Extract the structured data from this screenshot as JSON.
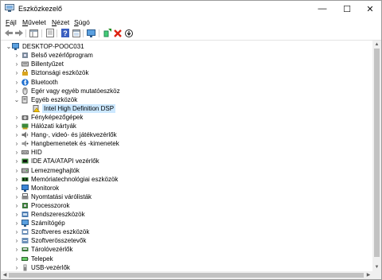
{
  "window": {
    "title": "Eszközkezelő",
    "minimize": "—",
    "maximize": "☐",
    "close": "✕"
  },
  "menu": [
    {
      "accel": "F",
      "rest": "ájl"
    },
    {
      "accel": "M",
      "rest": "űvelet"
    },
    {
      "accel": "N",
      "rest": "ézet"
    },
    {
      "accel": "S",
      "rest": "úgó"
    }
  ],
  "tree": {
    "root": "DESKTOP-POOC031",
    "items": [
      {
        "label": "Belső vezérlőprogram",
        "icon": "firmware-icon"
      },
      {
        "label": "Billentyűzet",
        "icon": "keyboard-icon"
      },
      {
        "label": "Biztonsági eszközök",
        "icon": "security-device-icon"
      },
      {
        "label": "Bluetooth",
        "icon": "bluetooth-icon"
      },
      {
        "label": "Egér vagy egyéb mutatóeszköz",
        "icon": "mouse-icon"
      },
      {
        "label": "Egyéb eszközök",
        "icon": "other-device-icon",
        "expanded": true
      },
      {
        "label": "Intel High Definition DSP",
        "icon": "unknown-device-warning-icon",
        "child": true,
        "selected": true
      },
      {
        "label": "Fényképezőgépek",
        "icon": "camera-icon"
      },
      {
        "label": "Hálózati kártyák",
        "icon": "network-adapter-icon"
      },
      {
        "label": "Hang-, videó- és játékvezérlők",
        "icon": "sound-icon"
      },
      {
        "label": "Hangbemenetek és -kimenetek",
        "icon": "audio-io-icon"
      },
      {
        "label": "HID",
        "icon": "hid-icon"
      },
      {
        "label": "IDE ATA/ATAPI vezérlők",
        "icon": "ide-controller-icon"
      },
      {
        "label": "Lemezmeghajtók",
        "icon": "disk-drive-icon"
      },
      {
        "label": "Memóriatechnológiai eszközök",
        "icon": "memory-device-icon"
      },
      {
        "label": "Monitorok",
        "icon": "monitor-icon"
      },
      {
        "label": "Nyomtatási várólisták",
        "icon": "print-queue-icon"
      },
      {
        "label": "Processzorok",
        "icon": "processor-icon"
      },
      {
        "label": "Rendszereszközök",
        "icon": "system-device-icon"
      },
      {
        "label": "Számítógép",
        "icon": "computer-icon"
      },
      {
        "label": "Szoftveres eszközök",
        "icon": "software-device-icon"
      },
      {
        "label": "Szoftverösszetevők",
        "icon": "software-component-icon"
      },
      {
        "label": "Tárolóvezérlők",
        "icon": "storage-controller-icon"
      },
      {
        "label": "Telepek",
        "icon": "battery-icon"
      },
      {
        "label": "USB-vezérlők",
        "icon": "usb-icon"
      }
    ]
  },
  "colors": {
    "selection": "#cce8ff",
    "accent": "#1a73c8"
  }
}
